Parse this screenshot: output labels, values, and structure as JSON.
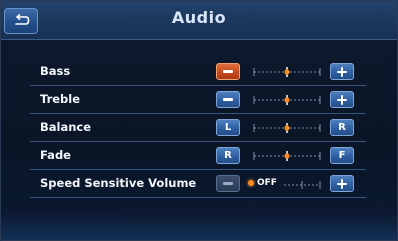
{
  "header": {
    "title": "Audio",
    "back_icon": "back-arrow-icon"
  },
  "settings": [
    {
      "label": "Bass",
      "decrease_label": "",
      "increase_label": "",
      "level": 0.5,
      "decrease_active": true
    },
    {
      "label": "Treble",
      "decrease_label": "",
      "increase_label": "",
      "level": 0.5
    },
    {
      "label": "Balance",
      "decrease_label": "L",
      "increase_label": "R",
      "level": 0.5
    },
    {
      "label": "Fade",
      "decrease_label": "R",
      "increase_label": "F",
      "level": 0.5
    },
    {
      "label": "Speed Sensitive Volume",
      "status": "OFF",
      "level": 0
    }
  ],
  "colors": {
    "accent_orange": "#ff8a1e",
    "button_blue": "#2d5d9f",
    "active_button": "#c4461c",
    "background": "#0e1a2e"
  }
}
